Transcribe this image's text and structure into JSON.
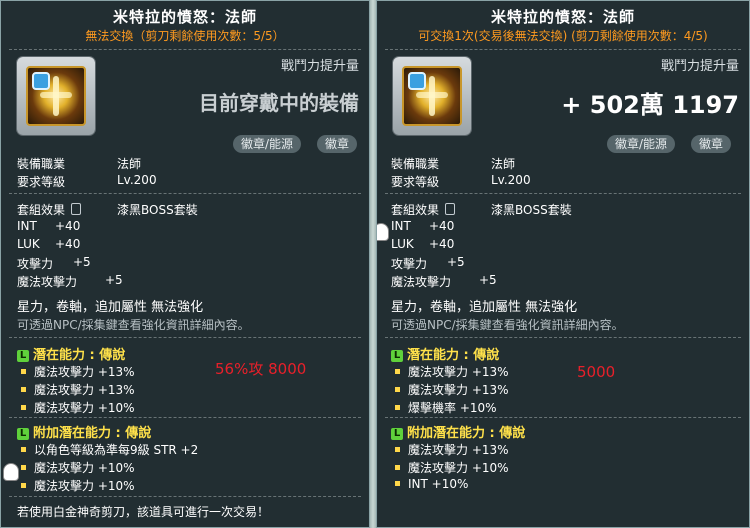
{
  "left": {
    "title": "米特拉的憤怒：法師",
    "subtitle": "無法交換（剪刀剩餘使用次數：5/5）",
    "power_label": "戰鬥力提升量",
    "power_value": "目前穿戴中的裝備",
    "pills": [
      "徽章/能源",
      "徽章"
    ],
    "job_label": "裝備職業",
    "job_value": "法師",
    "level_label": "要求等級",
    "level_value": "Lv.200",
    "set_label": "套組效果",
    "set_value": "漆黑BOSS套裝",
    "stats": [
      {
        "name": "INT",
        "value": "+40"
      },
      {
        "name": "LUK",
        "value": "+40"
      },
      {
        "name": "攻擊力",
        "value": "+5"
      },
      {
        "name": "魔法攻擊力",
        "value": "+5"
      }
    ],
    "flags": "星力，卷軸，追加屬性 無法強化",
    "info": "可透過NPC/採集鍵查看強化資訊詳細內容。",
    "potential_head": "潛在能力 : 傳說",
    "potential": [
      "魔法攻擊力 +13%",
      "魔法攻擊力 +13%",
      "魔法攻擊力 +10%"
    ],
    "note": "56%攻 8000",
    "bonus_head": "附加潛在能力 : 傳說",
    "bonus": [
      "以角色等級為準每9級 STR +2",
      "魔法攻擊力 +10%",
      "魔法攻擊力 +10%"
    ],
    "footer": "若使用白金神奇剪刀，該道具可進行一次交易！"
  },
  "right": {
    "title": "米特拉的憤怒：法師",
    "subtitle": "可交換1次(交易後無法交換) (剪刀剩餘使用次數：4/5)",
    "power_label": "戰鬥力提升量",
    "power_value": "+ 502萬 1197",
    "pills": [
      "徽章/能源",
      "徽章"
    ],
    "job_label": "裝備職業",
    "job_value": "法師",
    "level_label": "要求等級",
    "level_value": "Lv.200",
    "set_label": "套組效果",
    "set_value": "漆黑BOSS套裝",
    "stats": [
      {
        "name": "INT",
        "value": "+40"
      },
      {
        "name": "LUK",
        "value": "+40"
      },
      {
        "name": "攻擊力",
        "value": "+5"
      },
      {
        "name": "魔法攻擊力",
        "value": "+5"
      }
    ],
    "flags": "星力，卷軸，追加屬性 無法強化",
    "info": "可透過NPC/採集鍵查看強化資訊詳細內容。",
    "potential_head": "潛在能力 : 傳說",
    "potential": [
      "魔法攻擊力 +13%",
      "魔法攻擊力 +13%",
      "爆擊機率 +10%"
    ],
    "note": "5000",
    "bonus_head": "附加潛在能力 : 傳說",
    "bonus": [
      "魔法攻擊力 +13%",
      "魔法攻擊力 +10%",
      "INT +10%"
    ]
  },
  "rank_letter": "L",
  "colors": {
    "subtitle_orange": "#ff9a1f",
    "legend_yellow": "#ffe14a",
    "note_red": "#e8202a",
    "rank_green": "#5fd13b"
  }
}
